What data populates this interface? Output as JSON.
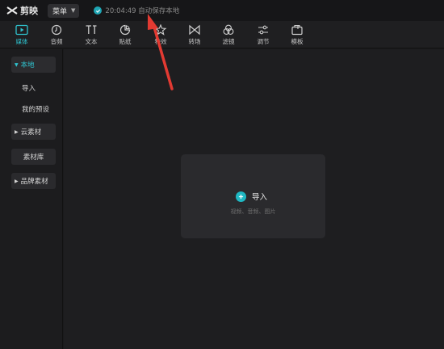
{
  "app": {
    "name": "剪映"
  },
  "menu": {
    "label": "菜单"
  },
  "save_status": {
    "text": "20:04:49 自动保存本地"
  },
  "toolbar": {
    "tools": [
      {
        "label": "媒体",
        "icon": "media-icon"
      },
      {
        "label": "音频",
        "icon": "audio-icon"
      },
      {
        "label": "文本",
        "icon": "text-icon"
      },
      {
        "label": "贴纸",
        "icon": "sticker-icon"
      },
      {
        "label": "特效",
        "icon": "effects-icon"
      },
      {
        "label": "转场",
        "icon": "transition-icon"
      },
      {
        "label": "滤镜",
        "icon": "filter-icon"
      },
      {
        "label": "调节",
        "icon": "adjust-icon"
      },
      {
        "label": "模板",
        "icon": "template-icon"
      }
    ],
    "active": "媒体"
  },
  "sidebar": {
    "items": [
      {
        "label": "本地"
      },
      {
        "label": "导入"
      },
      {
        "label": "我的预设"
      },
      {
        "label": "云素材"
      },
      {
        "label": "素材库"
      },
      {
        "label": "品牌素材"
      }
    ]
  },
  "import_panel": {
    "button_label": "导入",
    "hint": "视频、音频、图片"
  },
  "colors": {
    "accent": "#2fc3cf",
    "annotation_arrow": "#e23a32"
  }
}
